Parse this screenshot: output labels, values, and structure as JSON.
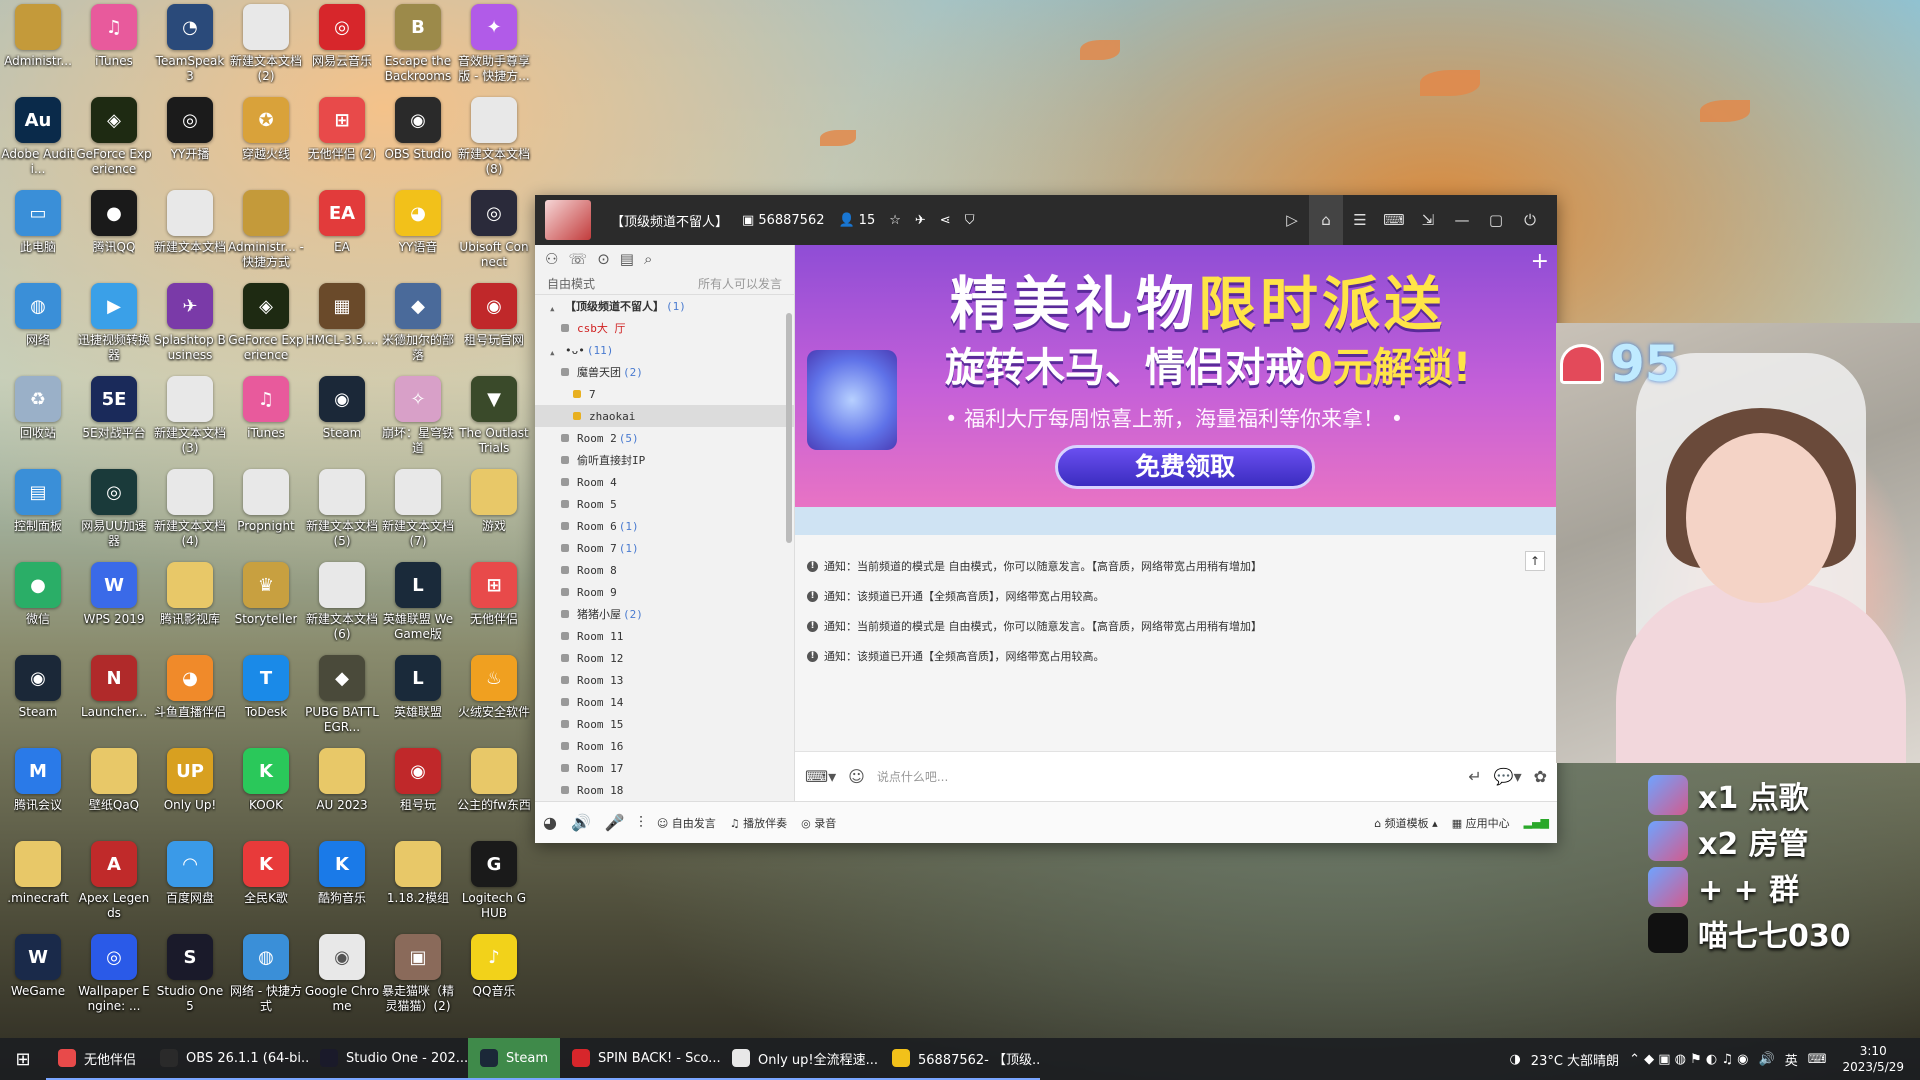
{
  "desktop": {
    "icons": [
      {
        "label": "Administr...",
        "icon": "user-folder-icon",
        "color": "#c49a3a",
        "glyph": ""
      },
      {
        "label": "iTunes",
        "icon": "itunes-icon",
        "color": "#e85a9c",
        "glyph": "♫"
      },
      {
        "label": "TeamSpeak 3",
        "icon": "teamspeak-icon",
        "color": "#2a4a7a",
        "glyph": "◔"
      },
      {
        "label": "新建文本文档 (2)",
        "icon": "text-file-icon",
        "color": "#e8e8e8",
        "glyph": ""
      },
      {
        "label": "网易云音乐",
        "icon": "netease-music-icon",
        "color": "#d7262b",
        "glyph": "◎"
      },
      {
        "label": "Escape the Backrooms",
        "icon": "game-icon",
        "color": "#9c8a4a",
        "glyph": "B"
      },
      {
        "label": "音效助手尊享版 - 快捷方...",
        "icon": "sound-assistant-icon",
        "color": "#b15be8",
        "glyph": "✦"
      },
      {
        "label": "Adobe Auditi...",
        "icon": "audition-icon",
        "color": "#0a2a4a",
        "glyph": "Au"
      },
      {
        "label": "GeForce Experience",
        "icon": "geforce-icon",
        "color": "#1e2a12",
        "glyph": "◈"
      },
      {
        "label": "YY开播",
        "icon": "yy-live-icon",
        "color": "#1b1b1b",
        "glyph": "◎"
      },
      {
        "label": "穿越火线",
        "icon": "crossfire-icon",
        "color": "#d9a23a",
        "glyph": "✪"
      },
      {
        "label": "无他伴侣 (2)",
        "icon": "wuta-icon",
        "color": "#e84a4a",
        "glyph": "⊞"
      },
      {
        "label": "OBS Studio",
        "icon": "obs-icon",
        "color": "#2a2a2a",
        "glyph": "◉"
      },
      {
        "label": "新建文本文档 (8)",
        "icon": "text-file-icon",
        "color": "#e8e8e8",
        "glyph": ""
      },
      {
        "label": "此电脑",
        "icon": "this-pc-icon",
        "color": "#3a8fd8",
        "glyph": "▭"
      },
      {
        "label": "腾讯QQ",
        "icon": "qq-icon",
        "color": "#1a1a1a",
        "glyph": "●"
      },
      {
        "label": "新建文本文档",
        "icon": "text-file-icon",
        "color": "#e8e8e8",
        "glyph": ""
      },
      {
        "label": "Administr... - 快捷方式",
        "icon": "user-folder-icon",
        "color": "#c49a3a",
        "glyph": ""
      },
      {
        "label": "EA",
        "icon": "ea-icon",
        "color": "#e23b3b",
        "glyph": "EA"
      },
      {
        "label": "YY语音",
        "icon": "yy-voice-icon",
        "color": "#f2c11a",
        "glyph": "◕"
      },
      {
        "label": "Ubisoft Connect",
        "icon": "ubisoft-icon",
        "color": "#2a2a3a",
        "glyph": "◎"
      },
      {
        "label": "网络",
        "icon": "network-icon",
        "color": "#3a8fd8",
        "glyph": "◍"
      },
      {
        "label": "迅捷视频转换器",
        "icon": "video-converter-icon",
        "color": "#3aa0e8",
        "glyph": "▶"
      },
      {
        "label": "Splashtop Business",
        "icon": "splashtop-icon",
        "color": "#7a3aa8",
        "glyph": "✈"
      },
      {
        "label": "GeForce Experience",
        "icon": "geforce-icon",
        "color": "#1e2a12",
        "glyph": "◈"
      },
      {
        "label": "HMCL-3.5....",
        "icon": "minecraft-launcher-icon",
        "color": "#6a4a2a",
        "glyph": "▦"
      },
      {
        "label": "米德加尔的部落",
        "icon": "game-icon",
        "color": "#4a6a9a",
        "glyph": "◆"
      },
      {
        "label": "租号玩官网",
        "icon": "zuhaowan-icon",
        "color": "#c0282a",
        "glyph": "◉"
      },
      {
        "label": "回收站",
        "icon": "recycle-bin-icon",
        "color": "#9ab0c8",
        "glyph": "♻"
      },
      {
        "label": "5E对战平台",
        "icon": "5e-icon",
        "color": "#1a2a5a",
        "glyph": "5E"
      },
      {
        "label": "新建文本文档 (3)",
        "icon": "text-file-icon",
        "color": "#e8e8e8",
        "glyph": ""
      },
      {
        "label": "iTunes",
        "icon": "itunes-icon",
        "color": "#e85a9c",
        "glyph": "♫"
      },
      {
        "label": "Steam",
        "icon": "steam-icon",
        "color": "#1b2838",
        "glyph": "◉"
      },
      {
        "label": "崩坏：星穹铁道",
        "icon": "starrail-icon",
        "color": "#d8a0c8",
        "glyph": "✧"
      },
      {
        "label": "The Outlast Trials",
        "icon": "game-icon",
        "color": "#3a4a2a",
        "glyph": "▼"
      },
      {
        "label": "控制面板",
        "icon": "control-panel-icon",
        "color": "#3a8fd8",
        "glyph": "▤"
      },
      {
        "label": "网易UU加速器",
        "icon": "uu-icon",
        "color": "#1a3a3a",
        "glyph": "◎"
      },
      {
        "label": "新建文本文档 (4)",
        "icon": "text-file-icon",
        "color": "#e8e8e8",
        "glyph": ""
      },
      {
        "label": "Propnight",
        "icon": "text-file-icon",
        "color": "#e8e8e8",
        "glyph": ""
      },
      {
        "label": "新建文本文档 (5)",
        "icon": "text-file-icon",
        "color": "#e8e8e8",
        "glyph": ""
      },
      {
        "label": "新建文本文档 (7)",
        "icon": "text-file-icon",
        "color": "#e8e8e8",
        "glyph": ""
      },
      {
        "label": "游戏",
        "icon": "folder-icon",
        "color": "#e8c868",
        "glyph": ""
      },
      {
        "label": "微信",
        "icon": "wechat-icon",
        "color": "#2aae67",
        "glyph": "●"
      },
      {
        "label": "WPS 2019",
        "icon": "wps-icon",
        "color": "#3a6ae8",
        "glyph": "W"
      },
      {
        "label": "腾讯影视库",
        "icon": "folder-icon",
        "color": "#e8c868",
        "glyph": ""
      },
      {
        "label": "Storyteller",
        "icon": "game-icon",
        "color": "#c8a040",
        "glyph": "♛"
      },
      {
        "label": "新建文本文档 (6)",
        "icon": "text-file-icon",
        "color": "#e8e8e8",
        "glyph": ""
      },
      {
        "label": "英雄联盟 WeGame版",
        "icon": "lol-icon",
        "color": "#1a2a3a",
        "glyph": "L"
      },
      {
        "label": "无他伴侣",
        "icon": "wuta-icon",
        "color": "#e84a4a",
        "glyph": "⊞"
      },
      {
        "label": "Steam",
        "icon": "steam-icon",
        "color": "#1b2838",
        "glyph": "◉"
      },
      {
        "label": "Launcher...",
        "icon": "naraka-icon",
        "color": "#b02a2a",
        "glyph": "N"
      },
      {
        "label": "斗鱼直播伴侣",
        "icon": "douyu-icon",
        "color": "#f08a2a",
        "glyph": "◕"
      },
      {
        "label": "ToDesk",
        "icon": "todesk-icon",
        "color": "#1a8ae8",
        "glyph": "T"
      },
      {
        "label": "PUBG BATTLEGR...",
        "icon": "pubg-icon",
        "color": "#4a4a3a",
        "glyph": "◆"
      },
      {
        "label": "英雄联盟",
        "icon": "lol-icon",
        "color": "#1a2a3a",
        "glyph": "L"
      },
      {
        "label": "火绒安全软件",
        "icon": "huorong-icon",
        "color": "#f0a020",
        "glyph": "♨"
      },
      {
        "label": "腾讯会议",
        "icon": "tencent-meeting-icon",
        "color": "#2a7ae8",
        "glyph": "M"
      },
      {
        "label": "壁纸QaQ",
        "icon": "wallpaper-icon",
        "color": "#e8c868",
        "glyph": ""
      },
      {
        "label": "Only Up!",
        "icon": "onlyup-icon",
        "color": "#d8a020",
        "glyph": "UP"
      },
      {
        "label": "KOOK",
        "icon": "kook-icon",
        "color": "#2ac85a",
        "glyph": "K"
      },
      {
        "label": "AU 2023",
        "icon": "folder-icon",
        "color": "#e8c868",
        "glyph": ""
      },
      {
        "label": "租号玩",
        "icon": "zuhaowan-icon",
        "color": "#c0282a",
        "glyph": "◉"
      },
      {
        "label": "公主的fw东西",
        "icon": "folder-icon",
        "color": "#e8c868",
        "glyph": ""
      },
      {
        "label": ".minecraft",
        "icon": "folder-icon",
        "color": "#e8c868",
        "glyph": ""
      },
      {
        "label": "Apex Legends",
        "icon": "apex-icon",
        "color": "#c02a2a",
        "glyph": "A"
      },
      {
        "label": "百度网盘",
        "icon": "baidu-pan-icon",
        "color": "#3a9ae8",
        "glyph": "◠"
      },
      {
        "label": "全民K歌",
        "icon": "kge-icon",
        "color": "#e83a3a",
        "glyph": "K"
      },
      {
        "label": "酷狗音乐",
        "icon": "kugou-icon",
        "color": "#1a7ae8",
        "glyph": "K"
      },
      {
        "label": "1.18.2模组",
        "icon": "folder-icon",
        "color": "#e8c868",
        "glyph": ""
      },
      {
        "label": "Logitech G HUB",
        "icon": "logitech-icon",
        "color": "#1a1a1a",
        "glyph": "G"
      },
      {
        "label": "WeGame",
        "icon": "wegame-icon",
        "color": "#1a2a4a",
        "glyph": "W"
      },
      {
        "label": "Wallpaper Engine: ...",
        "icon": "wallpaper-engine-icon",
        "color": "#2a5ae8",
        "glyph": "◎"
      },
      {
        "label": "Studio One 5",
        "icon": "studio-one-icon",
        "color": "#1a1a2a",
        "glyph": "S"
      },
      {
        "label": "网络 - 快捷方式",
        "icon": "network-icon",
        "color": "#3a8fd8",
        "glyph": "◍"
      },
      {
        "label": "Google Chrome",
        "icon": "chrome-icon",
        "color": "#e8e8e8",
        "glyph": "◉"
      },
      {
        "label": "暴走猫咪（精灵猫猫）(2)",
        "icon": "game-icon",
        "color": "#8a6a5a",
        "glyph": "▣"
      },
      {
        "label": "QQ音乐",
        "icon": "qq-music-icon",
        "color": "#f2d21a",
        "glyph": "♪"
      }
    ]
  },
  "chat_window": {
    "channel_name": "【顶级频道不留人】",
    "channel_id": "56887562",
    "online_count": "15",
    "mode_label": "自由模式",
    "permission_label": "所有人可以发言",
    "tree": [
      {
        "label": "【顶级频道不留人】",
        "count": "(1)",
        "level": 0,
        "style": "bold"
      },
      {
        "label": "csb大 厅",
        "count": "",
        "level": 1,
        "style": "red"
      },
      {
        "label": "•ᴗ•",
        "count": "(11)",
        "level": 0,
        "style": ""
      },
      {
        "label": "魔兽天团",
        "count": "(2)",
        "level": 1,
        "style": ""
      },
      {
        "label": "7",
        "count": "",
        "level": 2,
        "style": ""
      },
      {
        "label": "zhaokai",
        "count": "",
        "level": 2,
        "style": "sel"
      },
      {
        "label": "Room 2",
        "count": "(5)",
        "level": 1,
        "style": ""
      },
      {
        "label": "偷听直接封IP",
        "count": "",
        "level": 1,
        "style": ""
      },
      {
        "label": "Room 4",
        "count": "",
        "level": 1,
        "style": ""
      },
      {
        "label": "Room 5",
        "count": "",
        "level": 1,
        "style": ""
      },
      {
        "label": "Room 6",
        "count": "(1)",
        "level": 1,
        "style": ""
      },
      {
        "label": "Room 7",
        "count": "(1)",
        "level": 1,
        "style": ""
      },
      {
        "label": "Room 8",
        "count": "",
        "level": 1,
        "style": ""
      },
      {
        "label": "Room 9",
        "count": "",
        "level": 1,
        "style": ""
      },
      {
        "label": "猪猪小屋",
        "count": "(2)",
        "level": 1,
        "style": ""
      },
      {
        "label": "Room 11",
        "count": "",
        "level": 1,
        "style": ""
      },
      {
        "label": "Room 12",
        "count": "",
        "level": 1,
        "style": ""
      },
      {
        "label": "Room 13",
        "count": "",
        "level": 1,
        "style": ""
      },
      {
        "label": "Room 14",
        "count": "",
        "level": 1,
        "style": ""
      },
      {
        "label": "Room 15",
        "count": "",
        "level": 1,
        "style": ""
      },
      {
        "label": "Room 16",
        "count": "",
        "level": 1,
        "style": ""
      },
      {
        "label": "Room 17",
        "count": "",
        "level": 1,
        "style": ""
      },
      {
        "label": "Room 18",
        "count": "",
        "level": 1,
        "style": ""
      }
    ],
    "banner": {
      "line1_white": "精美礼物",
      "line1_yellow": "限时派送",
      "line2_white": "旋转木马、情侣对戒",
      "line2_yellow": "0元解锁!",
      "line3": "• 福利大厅每周惊喜上新，海量福利等你来拿！ •",
      "button": "免费领取"
    },
    "messages": [
      "通知：当前频道的模式是 自由模式，你可以随意发言。【高音质，网络带宽占用稍有增加】",
      "通知：该频道已开通【全频高音质】，网络带宽占用较高。",
      "通知：当前频道的模式是 自由模式，你可以随意发言。【高音质，网络带宽占用稍有增加】",
      "通知：该频道已开通【全频高音质】，网络带宽占用较高。"
    ],
    "input_placeholder": "说点什么吧...",
    "bottom": {
      "free_speech": "自由发言",
      "play_music": "播放伴奏",
      "record": "录音",
      "template": "频道模板",
      "app_center": "应用中心"
    }
  },
  "stream_overlay": {
    "heart_count": "95",
    "rows": [
      "x1 点歌",
      "x2 房管",
      "+ + 群",
      "喵七七030"
    ]
  },
  "taskbar": {
    "apps": [
      {
        "label": "无他伴侣",
        "color": "#e84a4a",
        "active": false
      },
      {
        "label": "OBS 26.1.1 (64-bi...",
        "color": "#2a2a2a",
        "active": false
      },
      {
        "label": "Studio One - 202...",
        "color": "#1a1a2a",
        "active": false
      },
      {
        "label": "Steam",
        "color": "#1b2838",
        "active": true
      },
      {
        "label": "SPIN BACK! - Sco...",
        "color": "#d7262b",
        "active": false
      },
      {
        "label": "Only up!全流程速...",
        "color": "#e8e8e8",
        "active": false
      },
      {
        "label": "56887562- 【顶级...",
        "color": "#f2c11a",
        "active": false
      }
    ],
    "weather": "23°C 大部晴朗",
    "ime": "英",
    "time": "3:10",
    "date": "2023/5/29"
  }
}
